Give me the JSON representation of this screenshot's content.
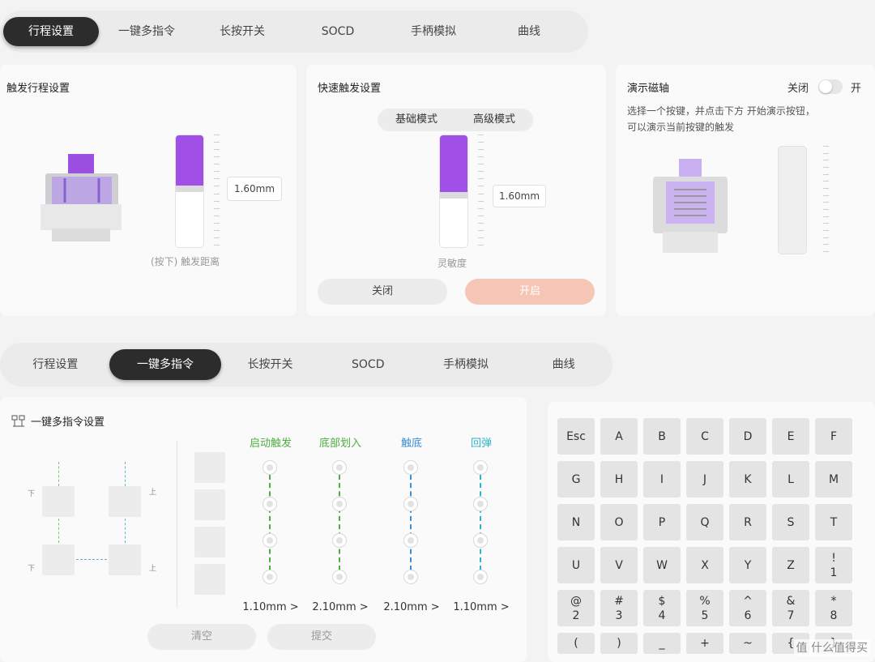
{
  "top_tabs": [
    "行程设置",
    "一键多指令",
    "长按开关",
    "SOCD",
    "手柄模拟",
    "曲线"
  ],
  "top_active": 0,
  "trigger_panel": {
    "title": "触发行程设置",
    "value": "1.60mm",
    "caption": "(按下) 触发距离",
    "fill_fraction": 0.44
  },
  "rapid_panel": {
    "title": "快速触发设置",
    "mode_basic": "基础模式",
    "mode_advanced": "高级模式",
    "value": "1.60mm",
    "caption": "灵敏度",
    "off_label": "关闭",
    "on_label": "开启",
    "fill_fraction": 0.5
  },
  "demo_panel": {
    "title": "演示磁轴",
    "toggle_off": "关闭",
    "toggle_on": "开",
    "desc_line1": "选择一个按键，并点击下方 开始演示按钮，",
    "desc_line2": "可以演示当前按键的触发"
  },
  "bottom_tabs": [
    "行程设置",
    "一键多指令",
    "长按开关",
    "SOCD",
    "手柄模拟",
    "曲线"
  ],
  "bottom_active": 1,
  "multi_panel": {
    "title": "一键多指令设置",
    "side_marks": [
      "下",
      "下",
      "上",
      "上"
    ],
    "steps": [
      {
        "label": "启动触发",
        "color": "#4cae3f",
        "value": "1.10mm >"
      },
      {
        "label": "底部划入",
        "color": "#4cae3f",
        "value": "2.10mm >"
      },
      {
        "label": "触底",
        "color": "#3a8fd6",
        "value": "2.10mm >"
      },
      {
        "label": "回弹",
        "color": "#2fb4c9",
        "value": "1.10mm >"
      }
    ],
    "clear_label": "清空",
    "submit_label": "提交"
  },
  "keys": [
    [
      "Esc"
    ],
    [
      "A"
    ],
    [
      "B"
    ],
    [
      "C"
    ],
    [
      "D"
    ],
    [
      "E"
    ],
    [
      "F"
    ],
    [
      "G"
    ],
    [
      "H"
    ],
    [
      "I"
    ],
    [
      "J"
    ],
    [
      "K"
    ],
    [
      "L"
    ],
    [
      "M"
    ],
    [
      "N"
    ],
    [
      "O"
    ],
    [
      "P"
    ],
    [
      "Q"
    ],
    [
      "R"
    ],
    [
      "S"
    ],
    [
      "T"
    ],
    [
      "U"
    ],
    [
      "V"
    ],
    [
      "W"
    ],
    [
      "X"
    ],
    [
      "Y"
    ],
    [
      "Z"
    ],
    [
      "!",
      "1"
    ],
    [
      "@",
      "2"
    ],
    [
      "#",
      "3"
    ],
    [
      "$",
      "4"
    ],
    [
      "%",
      "5"
    ],
    [
      "^",
      "6"
    ],
    [
      "&",
      "7"
    ],
    [
      "*",
      "8"
    ],
    [
      "("
    ],
    [
      ")"
    ],
    [
      "_"
    ],
    [
      "+"
    ],
    [
      "~"
    ],
    [
      "{"
    ],
    [
      "}"
    ]
  ],
  "watermark": "值 什么值得买",
  "colors": {
    "accent_purple": "#a050e6",
    "active_tab": "#2c2c2c",
    "on_button": "#f5c6b6"
  }
}
